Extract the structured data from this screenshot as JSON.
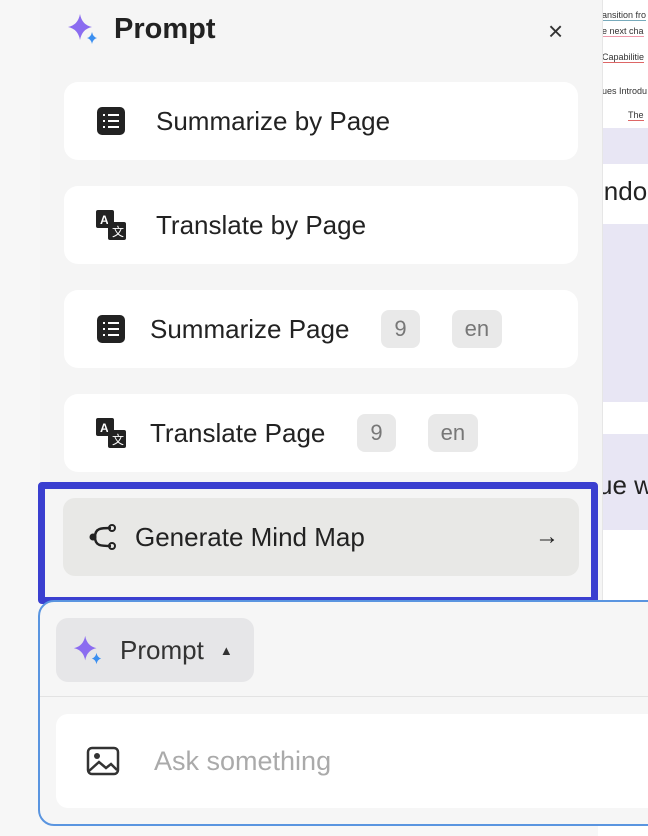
{
  "background_doc": {
    "lines": [
      "ansition fro",
      "e next cha",
      "Capabilitie",
      "ues Introdu",
      "The"
    ],
    "big_text": [
      "indo",
      "ue w"
    ]
  },
  "panel": {
    "title": "Prompt",
    "close": "×",
    "items": [
      {
        "label": "Summarize by Page",
        "icon": "list-icon"
      },
      {
        "label": "Translate by Page",
        "icon": "translate-icon"
      },
      {
        "label": "Summarize Page",
        "icon": "list-icon",
        "page": "9",
        "lang": "en"
      },
      {
        "label": "Translate Page",
        "icon": "translate-icon",
        "page": "9",
        "lang": "en"
      }
    ],
    "mind_map": {
      "label": "Generate Mind Map",
      "arrow": "→"
    }
  },
  "composer": {
    "prompt_button": "Prompt",
    "caret": "▲",
    "placeholder": "Ask something"
  },
  "colors": {
    "highlight": "#3a3fd0",
    "input_border": "#5a95e0",
    "sparkle_purple": "#8b6cf0",
    "sparkle_blue": "#3b8ff0"
  }
}
